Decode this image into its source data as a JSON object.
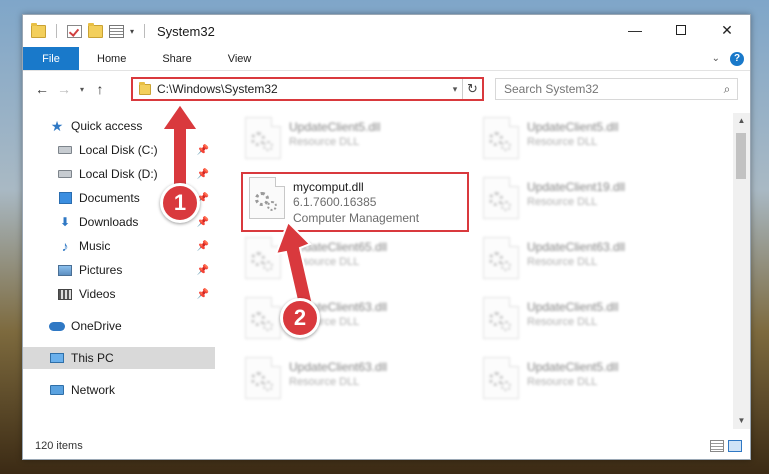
{
  "window": {
    "title": "System32"
  },
  "ribbon": {
    "file_tab": "File",
    "tabs": [
      "Home",
      "Share",
      "View"
    ],
    "help": "?"
  },
  "window_controls": {
    "minimize": "—",
    "close": "✕"
  },
  "address": {
    "path": "C:\\Windows\\System32"
  },
  "search": {
    "placeholder": "Search System32"
  },
  "sidebar": {
    "items": [
      {
        "label": "Quick access",
        "icon": "star-icon",
        "pinned": false
      },
      {
        "label": "Local Disk (C:)",
        "icon": "drive-icon",
        "pinned": true
      },
      {
        "label": "Local Disk (D:)",
        "icon": "drive-icon",
        "pinned": true
      },
      {
        "label": "Documents",
        "icon": "documents-icon",
        "pinned": true
      },
      {
        "label": "Downloads",
        "icon": "download-icon",
        "pinned": true
      },
      {
        "label": "Music",
        "icon": "music-icon",
        "pinned": true
      },
      {
        "label": "Pictures",
        "icon": "pictures-icon",
        "pinned": true
      },
      {
        "label": "Videos",
        "icon": "videos-icon",
        "pinned": true
      },
      {
        "label": "OneDrive",
        "icon": "onedrive-icon",
        "pinned": false
      },
      {
        "label": "This PC",
        "icon": "pc-icon",
        "pinned": false,
        "selected": true
      },
      {
        "label": "Network",
        "icon": "network-icon",
        "pinned": false
      }
    ]
  },
  "files": [
    {
      "name": "UpdateClient5.dll",
      "type": "Resource DLL",
      "blurred": true
    },
    {
      "name": "UpdateClient5.dll",
      "type": "Resource DLL",
      "blurred": true
    },
    {
      "name": "mycomput.dll",
      "version": "6.1.7600.16385",
      "type": "Computer Management",
      "blurred": false
    },
    {
      "name": "UpdateClient19.dll",
      "type": "Resource DLL",
      "blurred": true
    },
    {
      "name": "UpdateClient65.dll",
      "type": "Resource DLL",
      "blurred": true
    },
    {
      "name": "UpdateClient63.dll",
      "type": "Resource DLL",
      "blurred": true
    },
    {
      "name": "UpdateClient63.dll",
      "type": "Resource DLL",
      "blurred": true
    },
    {
      "name": "UpdateClient5.dll",
      "type": "Resource DLL",
      "blurred": true
    },
    {
      "name": "UpdateClient63.dll",
      "type": "Resource DLL",
      "blurred": true
    },
    {
      "name": "UpdateClient5.dll",
      "type": "Resource DLL",
      "blurred": true
    }
  ],
  "status": {
    "item_count": "120 items"
  },
  "annotations": {
    "step1": "1",
    "step2": "2",
    "color": "#d9393d"
  }
}
